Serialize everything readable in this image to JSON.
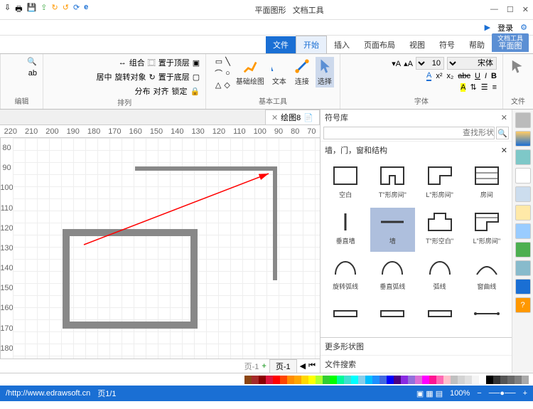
{
  "window": {
    "title_context": "文档工具",
    "title_sub": "平面图形",
    "login": "登录"
  },
  "tabs": {
    "items": [
      "文件",
      "开始",
      "插入",
      "页面布局",
      "视图",
      "符号",
      "帮助",
      "平面图"
    ],
    "active_index": 7
  },
  "ribbon": {
    "group_file": {
      "label": "文件"
    },
    "group_font": {
      "label": "字体",
      "font_family": "宋体",
      "font_size": "10"
    },
    "group_tools": {
      "label": "基本工具",
      "items": [
        "选择",
        "连接",
        "文本",
        "基础绘图"
      ]
    },
    "group_arrange": {
      "label": "排列",
      "items": [
        "置于顶层",
        "置于底层",
        "组合",
        "旋转对象",
        "锁定",
        "居中",
        "对齐",
        "分布"
      ]
    },
    "group_edit": {
      "label": "编辑"
    }
  },
  "rightpanel": {
    "header": "符号库",
    "search_placeholder": "查找形状",
    "section": "墙，门，窗和结构",
    "more_shapes": "更多形状图",
    "file_search": "文件搜索"
  },
  "shapes": [
    {
      "name": "房间"
    },
    {
      "name": "\"L\"形房间"
    },
    {
      "name": "\"T\"形房间"
    },
    {
      "name": "空白"
    },
    {
      "name": "\"L\"形房间"
    },
    {
      "name": "\"T\"形空白"
    },
    {
      "name": "墙"
    },
    {
      "name": "垂直墙"
    },
    {
      "name": "窗曲线"
    },
    {
      "name": "弧线"
    },
    {
      "name": "垂直弧线"
    },
    {
      "name": "旋转弧线"
    },
    {
      "name": ""
    },
    {
      "name": ""
    },
    {
      "name": ""
    },
    {
      "name": ""
    }
  ],
  "document": {
    "tab_name": "绘图8",
    "page_current": "页-1",
    "page_alt": "页-1"
  },
  "ruler_h": [
    "70",
    "80",
    "90",
    "100",
    "110",
    "120",
    "130",
    "140",
    "150",
    "160",
    "170",
    "180",
    "190",
    "200",
    "210",
    "220"
  ],
  "ruler_v": [
    "80",
    "90",
    "100",
    "110",
    "120",
    "130",
    "140",
    "150",
    "160",
    "170",
    "180"
  ],
  "status": {
    "url": "http://www.edrawsoft.cn/",
    "pages": "页1/1",
    "zoom": "100%"
  },
  "colors": [
    "#a9a9a9",
    "#808080",
    "#696969",
    "#555",
    "#333",
    "#000",
    "#fff",
    "#f5f5f5",
    "#e0e0e0",
    "#d3d3d3",
    "#c0c0c0",
    "#ffc0cb",
    "#ff69b4",
    "#ff1493",
    "#ff00ff",
    "#da70d6",
    "#9370db",
    "#8a2be2",
    "#4b0082",
    "#0000ff",
    "#4169e1",
    "#1e90ff",
    "#00bfff",
    "#87ceeb",
    "#00ffff",
    "#40e0d0",
    "#00fa9a",
    "#00ff00",
    "#32cd32",
    "#adff2f",
    "#ffff00",
    "#ffd700",
    "#ffa500",
    "#ff8c00",
    "#ff4500",
    "#ff0000",
    "#dc143c",
    "#8b0000",
    "#a52a2a",
    "#8b4513"
  ]
}
